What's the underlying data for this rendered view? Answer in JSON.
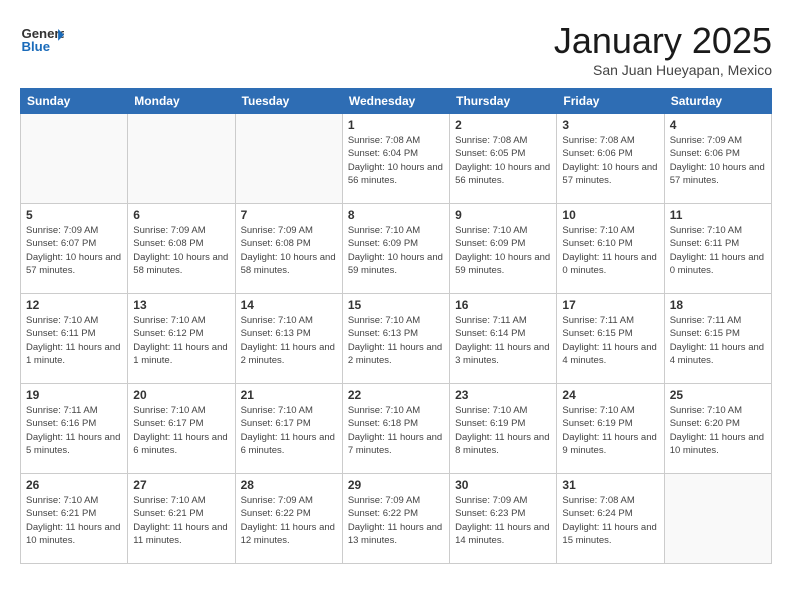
{
  "header": {
    "logo": {
      "general": "General",
      "blue": "Blue"
    },
    "title": "January 2025",
    "location": "San Juan Hueyapan, Mexico"
  },
  "days_of_week": [
    "Sunday",
    "Monday",
    "Tuesday",
    "Wednesday",
    "Thursday",
    "Friday",
    "Saturday"
  ],
  "weeks": [
    [
      {
        "day": "",
        "empty": true
      },
      {
        "day": "",
        "empty": true
      },
      {
        "day": "",
        "empty": true
      },
      {
        "day": "1",
        "sunrise": "7:08 AM",
        "sunset": "6:04 PM",
        "daylight": "10 hours and 56 minutes."
      },
      {
        "day": "2",
        "sunrise": "7:08 AM",
        "sunset": "6:05 PM",
        "daylight": "10 hours and 56 minutes."
      },
      {
        "day": "3",
        "sunrise": "7:08 AM",
        "sunset": "6:06 PM",
        "daylight": "10 hours and 57 minutes."
      },
      {
        "day": "4",
        "sunrise": "7:09 AM",
        "sunset": "6:06 PM",
        "daylight": "10 hours and 57 minutes."
      }
    ],
    [
      {
        "day": "5",
        "sunrise": "7:09 AM",
        "sunset": "6:07 PM",
        "daylight": "10 hours and 57 minutes."
      },
      {
        "day": "6",
        "sunrise": "7:09 AM",
        "sunset": "6:08 PM",
        "daylight": "10 hours and 58 minutes."
      },
      {
        "day": "7",
        "sunrise": "7:09 AM",
        "sunset": "6:08 PM",
        "daylight": "10 hours and 58 minutes."
      },
      {
        "day": "8",
        "sunrise": "7:10 AM",
        "sunset": "6:09 PM",
        "daylight": "10 hours and 59 minutes."
      },
      {
        "day": "9",
        "sunrise": "7:10 AM",
        "sunset": "6:09 PM",
        "daylight": "10 hours and 59 minutes."
      },
      {
        "day": "10",
        "sunrise": "7:10 AM",
        "sunset": "6:10 PM",
        "daylight": "11 hours and 0 minutes."
      },
      {
        "day": "11",
        "sunrise": "7:10 AM",
        "sunset": "6:11 PM",
        "daylight": "11 hours and 0 minutes."
      }
    ],
    [
      {
        "day": "12",
        "sunrise": "7:10 AM",
        "sunset": "6:11 PM",
        "daylight": "11 hours and 1 minute."
      },
      {
        "day": "13",
        "sunrise": "7:10 AM",
        "sunset": "6:12 PM",
        "daylight": "11 hours and 1 minute."
      },
      {
        "day": "14",
        "sunrise": "7:10 AM",
        "sunset": "6:13 PM",
        "daylight": "11 hours and 2 minutes."
      },
      {
        "day": "15",
        "sunrise": "7:10 AM",
        "sunset": "6:13 PM",
        "daylight": "11 hours and 2 minutes."
      },
      {
        "day": "16",
        "sunrise": "7:11 AM",
        "sunset": "6:14 PM",
        "daylight": "11 hours and 3 minutes."
      },
      {
        "day": "17",
        "sunrise": "7:11 AM",
        "sunset": "6:15 PM",
        "daylight": "11 hours and 4 minutes."
      },
      {
        "day": "18",
        "sunrise": "7:11 AM",
        "sunset": "6:15 PM",
        "daylight": "11 hours and 4 minutes."
      }
    ],
    [
      {
        "day": "19",
        "sunrise": "7:11 AM",
        "sunset": "6:16 PM",
        "daylight": "11 hours and 5 minutes."
      },
      {
        "day": "20",
        "sunrise": "7:10 AM",
        "sunset": "6:17 PM",
        "daylight": "11 hours and 6 minutes."
      },
      {
        "day": "21",
        "sunrise": "7:10 AM",
        "sunset": "6:17 PM",
        "daylight": "11 hours and 6 minutes."
      },
      {
        "day": "22",
        "sunrise": "7:10 AM",
        "sunset": "6:18 PM",
        "daylight": "11 hours and 7 minutes."
      },
      {
        "day": "23",
        "sunrise": "7:10 AM",
        "sunset": "6:19 PM",
        "daylight": "11 hours and 8 minutes."
      },
      {
        "day": "24",
        "sunrise": "7:10 AM",
        "sunset": "6:19 PM",
        "daylight": "11 hours and 9 minutes."
      },
      {
        "day": "25",
        "sunrise": "7:10 AM",
        "sunset": "6:20 PM",
        "daylight": "11 hours and 10 minutes."
      }
    ],
    [
      {
        "day": "26",
        "sunrise": "7:10 AM",
        "sunset": "6:21 PM",
        "daylight": "11 hours and 10 minutes."
      },
      {
        "day": "27",
        "sunrise": "7:10 AM",
        "sunset": "6:21 PM",
        "daylight": "11 hours and 11 minutes."
      },
      {
        "day": "28",
        "sunrise": "7:09 AM",
        "sunset": "6:22 PM",
        "daylight": "11 hours and 12 minutes."
      },
      {
        "day": "29",
        "sunrise": "7:09 AM",
        "sunset": "6:22 PM",
        "daylight": "11 hours and 13 minutes."
      },
      {
        "day": "30",
        "sunrise": "7:09 AM",
        "sunset": "6:23 PM",
        "daylight": "11 hours and 14 minutes."
      },
      {
        "day": "31",
        "sunrise": "7:08 AM",
        "sunset": "6:24 PM",
        "daylight": "11 hours and 15 minutes."
      },
      {
        "day": "",
        "empty": true
      }
    ]
  ]
}
